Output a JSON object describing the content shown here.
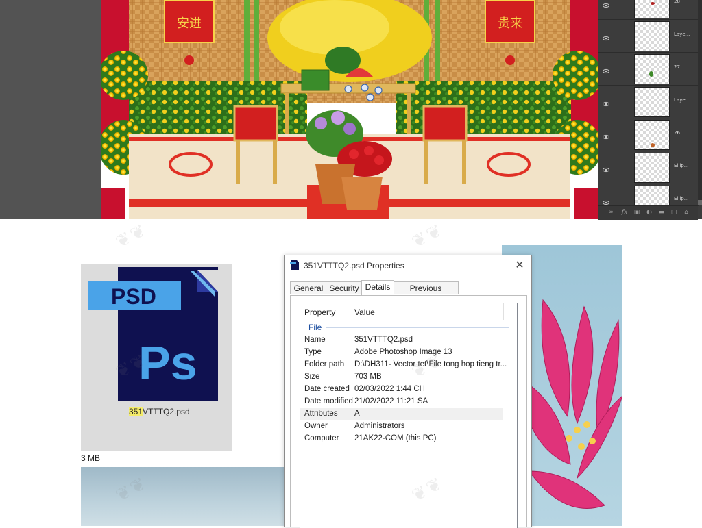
{
  "photoshop": {
    "canvas_banners": {
      "left": "安进",
      "right": "贵来"
    },
    "layers": [
      {
        "name": "28"
      },
      {
        "name": "Laye..."
      },
      {
        "name": "27"
      },
      {
        "name": "Laye..."
      },
      {
        "name": "26"
      },
      {
        "name": "Ellip..."
      },
      {
        "name": "Ellip..."
      }
    ],
    "footer_icons": [
      "link-icon",
      "fx-icon",
      "mask-icon",
      "adjustment-icon",
      "folder-icon",
      "new-layer-icon",
      "trash-icon"
    ]
  },
  "file_icon": {
    "badge": "PSD",
    "logo": "Ps",
    "file_name": "351VTTTQ2.psd",
    "highlighted_part": "351"
  },
  "size_fragment": "3 MB",
  "dialog": {
    "title": "351VTTTQ2.psd Properties",
    "close_glyph": "✕",
    "tabs": [
      "General",
      "Security",
      "Details",
      "Previous Versions"
    ],
    "active_tab": "Details",
    "columns": {
      "property": "Property",
      "value": "Value"
    },
    "group": "File",
    "rows": [
      {
        "key": "Name",
        "value": "351VTTTQ2.psd"
      },
      {
        "key": "Type",
        "value": "Adobe Photoshop Image 13"
      },
      {
        "key": "Folder path",
        "value": "D:\\DH311- Vector tet\\File tong hop tieng tr..."
      },
      {
        "key": "Size",
        "value": "703 MB"
      },
      {
        "key": "Date created",
        "value": "02/03/2022 1:44 CH"
      },
      {
        "key": "Date modified",
        "value": "21/02/2022 11:21 SA"
      },
      {
        "key": "Attributes",
        "value": "A"
      },
      {
        "key": "Owner",
        "value": "Administrators"
      },
      {
        "key": "Computer",
        "value": "21AK22-COM (this PC)"
      }
    ]
  },
  "colors": {
    "ps_dark": "#535353",
    "layers_bg": "#3c3c3c",
    "psd_navy": "#0f1150",
    "psd_blue": "#4aa3e8",
    "group_blue": "#1e4fa0",
    "lotus_pink": "#e0337a"
  }
}
